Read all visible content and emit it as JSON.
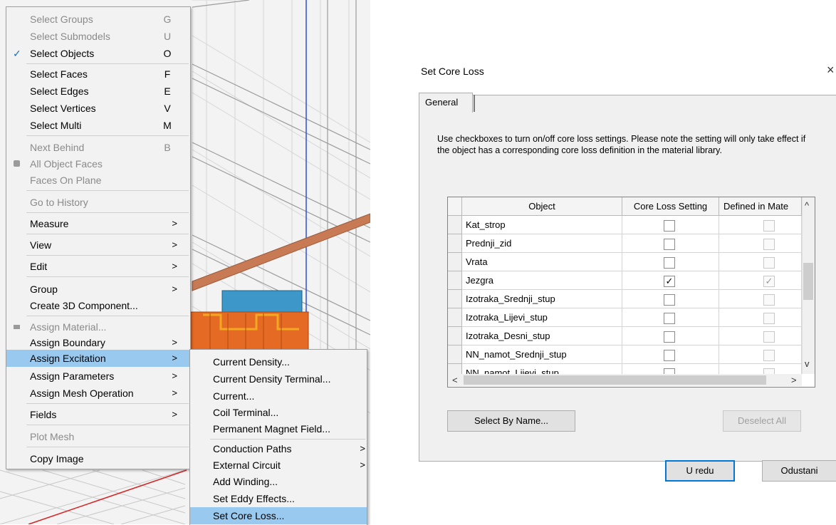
{
  "context_menu": {
    "items": [
      {
        "label": "Select Groups",
        "key": "G",
        "disabled": true
      },
      {
        "label": "Select Submodels",
        "key": "U",
        "disabled": true
      },
      {
        "label": "Select Objects",
        "key": "O",
        "checked": true
      },
      {
        "label": "Select Faces",
        "key": "F"
      },
      {
        "label": "Select Edges",
        "key": "E"
      },
      {
        "label": "Select Vertices",
        "key": "V"
      },
      {
        "label": "Select Multi",
        "key": "M"
      },
      {
        "label": "Next Behind",
        "key": "B",
        "disabled": true
      },
      {
        "label": "All Object Faces",
        "disabled": true
      },
      {
        "label": "Faces On Plane",
        "disabled": true
      },
      {
        "label": "Go to History",
        "disabled": true
      },
      {
        "label": "Measure",
        "submenu": true
      },
      {
        "label": "View",
        "submenu": true
      },
      {
        "label": "Edit",
        "submenu": true
      },
      {
        "label": "Group",
        "submenu": true
      },
      {
        "label": "Create 3D Component..."
      },
      {
        "label": "Assign Material...",
        "disabled": true
      },
      {
        "label": "Assign Boundary",
        "submenu": true
      },
      {
        "label": "Assign Excitation",
        "submenu": true,
        "highlighted": true
      },
      {
        "label": "Assign Parameters",
        "submenu": true
      },
      {
        "label": "Assign Mesh Operation",
        "submenu": true
      },
      {
        "label": "Fields",
        "submenu": true
      },
      {
        "label": "Plot Mesh",
        "disabled": true
      },
      {
        "label": "Copy Image"
      }
    ],
    "submenu_arrow": ">"
  },
  "excitation_submenu": {
    "items": [
      {
        "label": "Current Density..."
      },
      {
        "label": "Current Density Terminal..."
      },
      {
        "label": "Current..."
      },
      {
        "label": "Coil Terminal..."
      },
      {
        "label": "Permanent Magnet Field..."
      },
      {
        "label": "Conduction Paths",
        "submenu": true
      },
      {
        "label": "External Circuit",
        "submenu": true
      },
      {
        "label": "Add Winding..."
      },
      {
        "label": "Set Eddy Effects..."
      },
      {
        "label": "Set Core Loss...",
        "highlighted": true
      }
    ]
  },
  "dialog": {
    "title": "Set Core Loss",
    "close": "×",
    "tab": "General",
    "description": "Use checkboxes to turn on/off core loss settings.  Please note the setting will only take effect if the object has a corresponding core loss definition in the material library.",
    "grid": {
      "columns": [
        "Object",
        "Core Loss Setting",
        "Defined in Mate"
      ],
      "rows": [
        {
          "object": "Kat_strop",
          "core_loss": false,
          "defined": false
        },
        {
          "object": "Prednji_zid",
          "core_loss": false,
          "defined": false
        },
        {
          "object": "Vrata",
          "core_loss": false,
          "defined": false
        },
        {
          "object": "Jezgra",
          "core_loss": true,
          "defined": true
        },
        {
          "object": "Izotraka_Srednji_stup",
          "core_loss": false,
          "defined": false
        },
        {
          "object": "Izotraka_Lijevi_stup",
          "core_loss": false,
          "defined": false
        },
        {
          "object": "Izotraka_Desni_stup",
          "core_loss": false,
          "defined": false
        },
        {
          "object": "NN_namot_Srednji_stup",
          "core_loss": false,
          "defined": false
        },
        {
          "object": "NN_namot_Lijevi_stup",
          "core_loss": false,
          "defined": false
        }
      ],
      "scroll_up": "^",
      "scroll_down": "v",
      "scroll_left": "<",
      "scroll_right": ">"
    },
    "buttons": {
      "select_by_name": "Select By Name...",
      "deselect_all": "Deselect All",
      "ok": "U redu",
      "cancel": "Odustani"
    }
  }
}
